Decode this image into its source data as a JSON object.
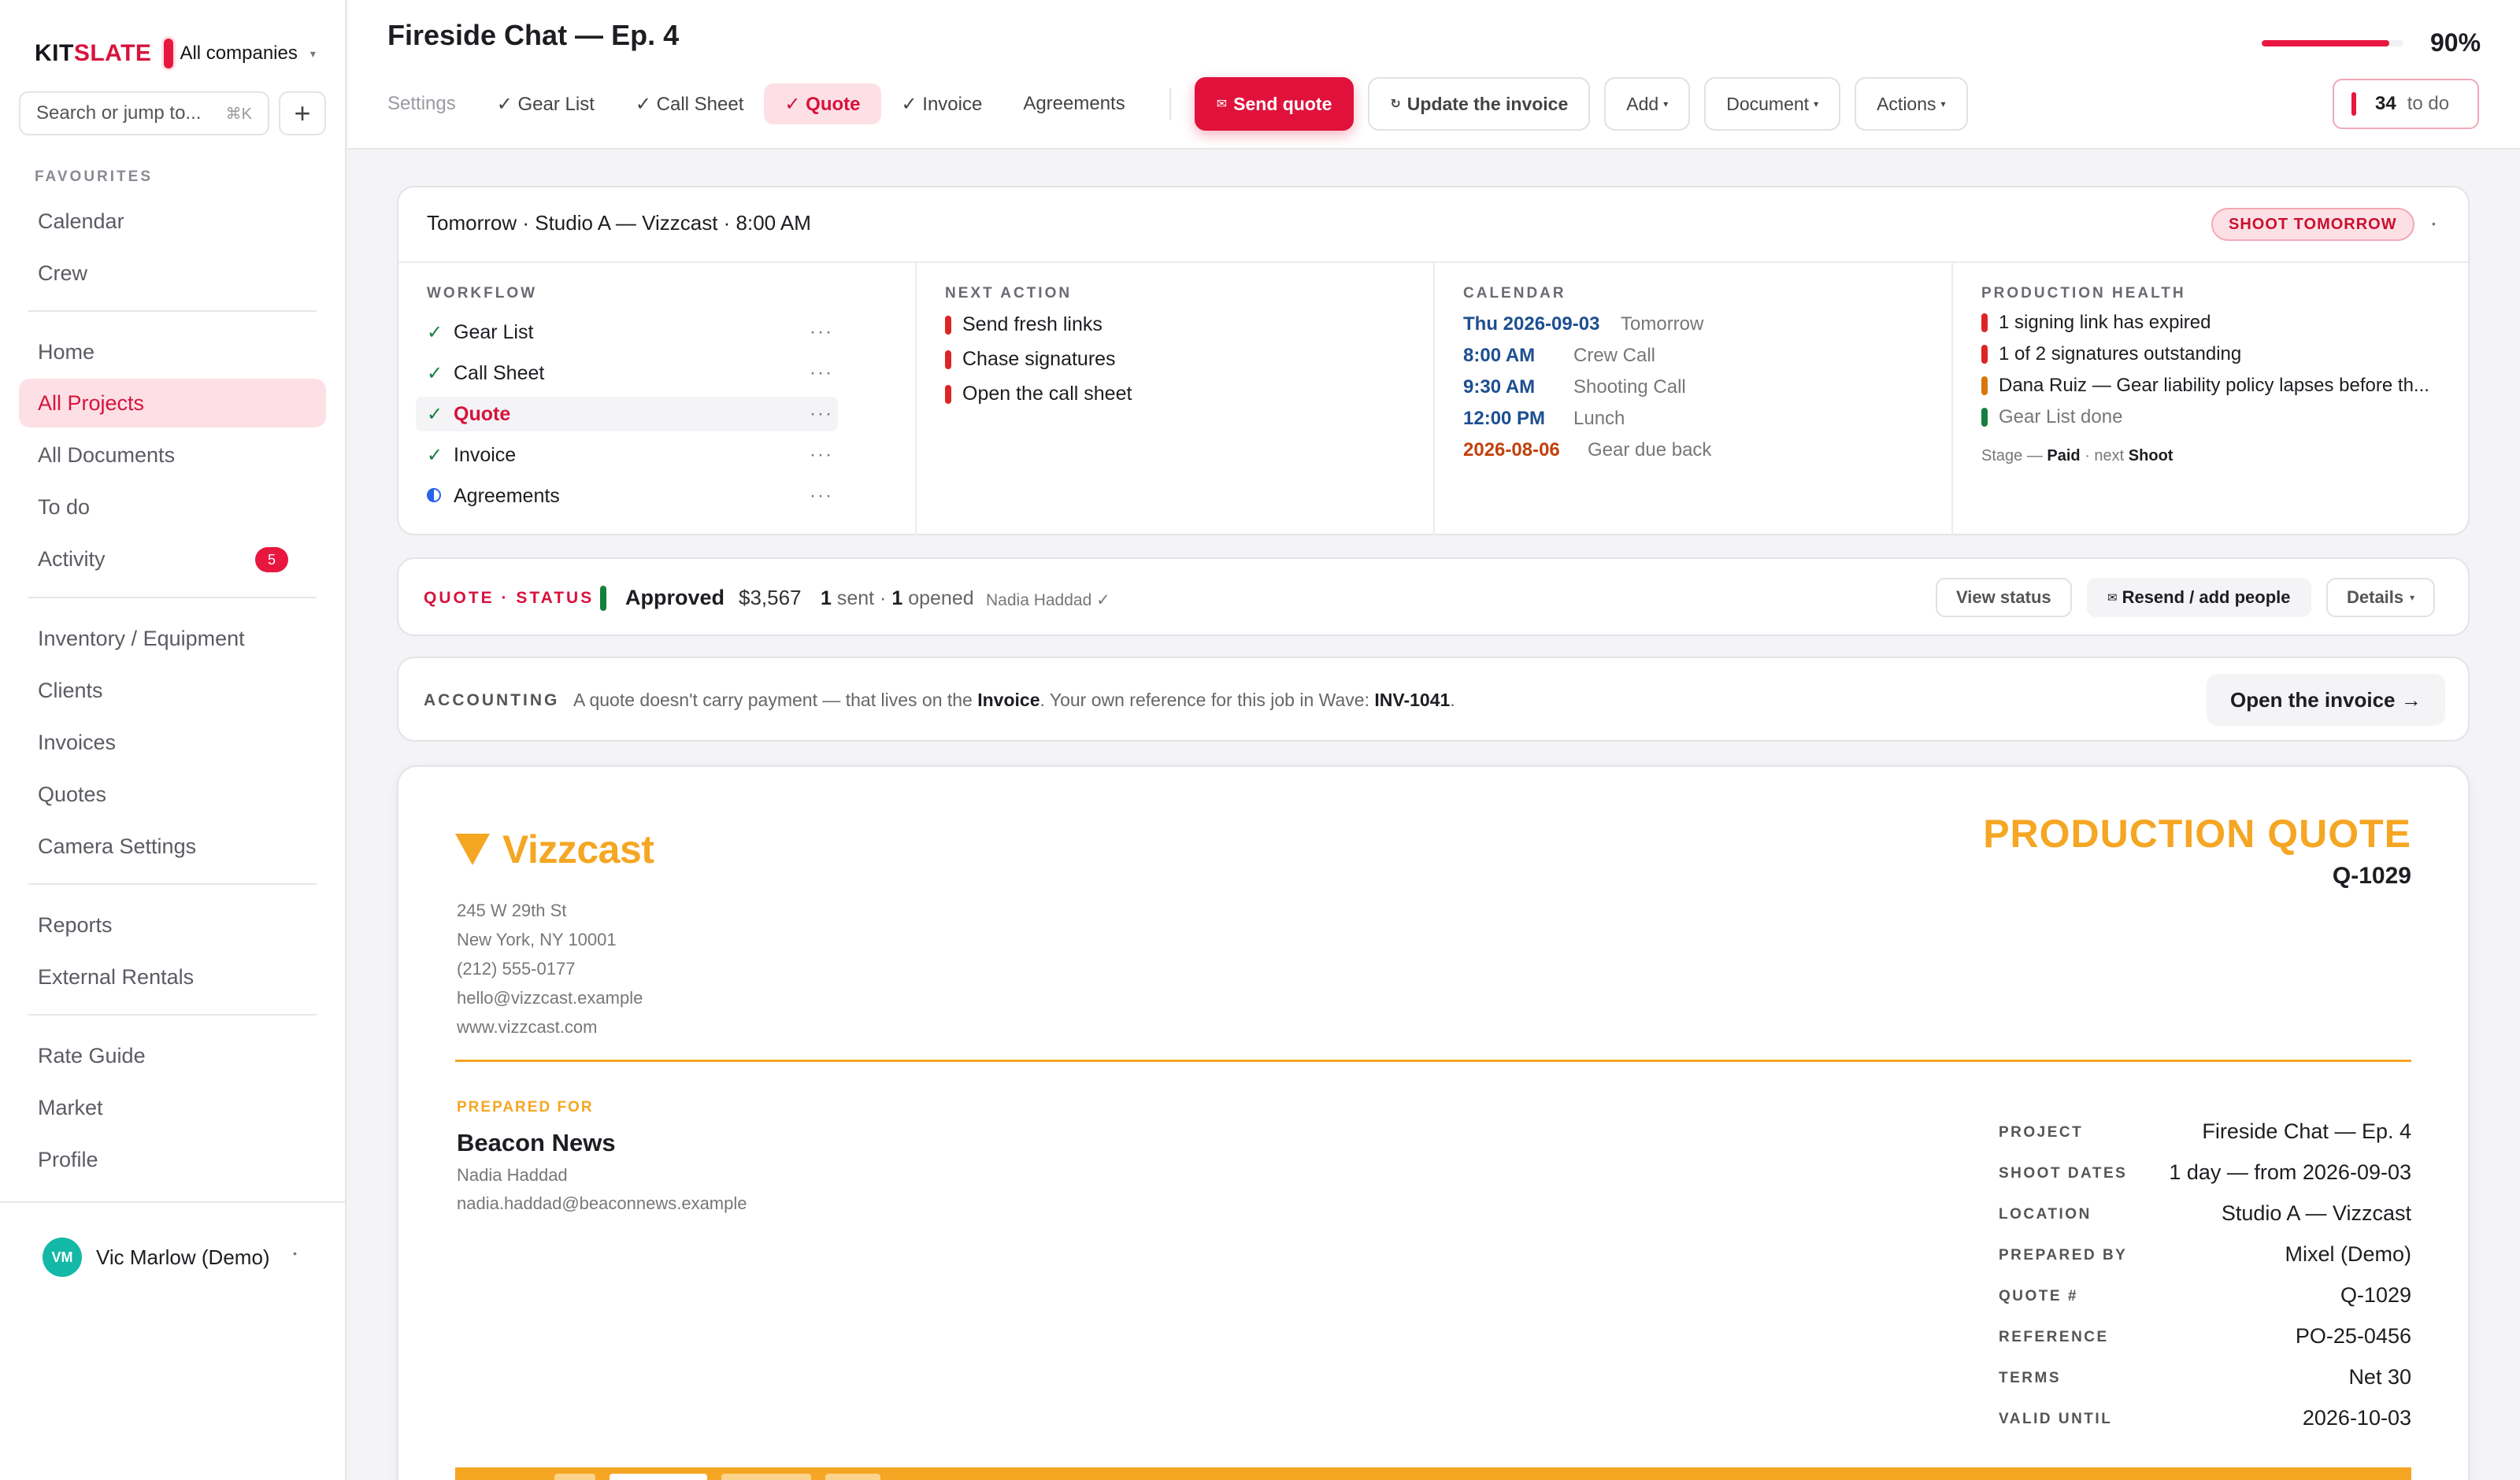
{
  "sidebar": {
    "brand": "KIT",
    "brand_accent": "SLATE",
    "company": "All companies",
    "search_placeholder": "Search or jump to...",
    "search_shortcut": "⌘K",
    "add_label": "+",
    "favourites_label": "FAVOURITES",
    "favourites": [
      "Calendar",
      "Crew"
    ],
    "group1": [
      "Home",
      "All Projects",
      "All Documents",
      "To do",
      "Activity"
    ],
    "activity_badge": "5",
    "group2": [
      "Inventory / Equipment",
      "Clients",
      "Invoices",
      "Quotes",
      "Camera Settings"
    ],
    "group3": [
      "Reports",
      "External Rentals"
    ],
    "group4": [
      "Rate Guide",
      "Market",
      "Profile"
    ],
    "user_initials": "VM",
    "user_name": "Vic Marlow (Demo)"
  },
  "header": {
    "title": "Fireside Chat — Ep. 4",
    "progress_percent": 90,
    "progress_label": "90%",
    "tabs": [
      "Settings",
      "✓ Gear List",
      "✓ Call Sheet",
      "✓ Quote",
      "✓ Invoice",
      "Agreements"
    ],
    "send_quote": "Send quote",
    "update_invoice": "Update the invoice",
    "add": "Add",
    "document": "Document",
    "actions": "Actions",
    "todo_count": "34",
    "todo_label": "to do"
  },
  "summary": {
    "headline": "Tomorrow · Studio A — Vizzcast · 8:00 AM",
    "badge": "SHOOT TOMORROW",
    "workflow_label": "WORKFLOW",
    "workflow": [
      "Gear List",
      "Call Sheet",
      "Quote",
      "Invoice",
      "Agreements"
    ],
    "next_action_label": "NEXT ACTION",
    "next_actions": [
      "Send fresh links",
      "Chase signatures",
      "Open the call sheet"
    ],
    "calendar_label": "CALENDAR",
    "calendar": [
      {
        "time": "Thu 2026-09-03",
        "desc": "Tomorrow"
      },
      {
        "time": "8:00 AM",
        "desc": "Crew Call"
      },
      {
        "time": "9:30 AM",
        "desc": "Shooting Call"
      },
      {
        "time": "12:00 PM",
        "desc": "Lunch"
      },
      {
        "time": "2026-08-06",
        "desc": "Gear due back"
      }
    ],
    "health_label": "PRODUCTION HEALTH",
    "health": [
      "1 signing link has expired",
      "1 of 2 signatures outstanding",
      "Dana Ruiz — Gear liability policy lapses before th...",
      "Gear List done"
    ],
    "stage_prefix": "Stage —",
    "stage_paid": "Paid",
    "stage_next": "· next",
    "stage_shoot": "Shoot"
  },
  "quote_status": {
    "label": "QUOTE · STATUS",
    "status": "Approved",
    "amount": "$3,567",
    "sent_count": "1",
    "sent_label": "sent ·",
    "opened_count": "1",
    "opened_label": "opened",
    "approved_by": "Nadia Haddad ✓",
    "view_status": "View status",
    "resend": "Resend / add people",
    "details": "Details"
  },
  "accounting": {
    "label": "ACCOUNTING",
    "text_pre": "A quote doesn't carry payment — that lives on the",
    "text_link": "Invoice",
    "text_mid": ". Your own reference for this job in Wave:",
    "ref": "INV-1041",
    "text_end": ".",
    "open_invoice": "Open the invoice →"
  },
  "document": {
    "company": "Vizzcast",
    "address": [
      "245 W 29th St",
      "New York, NY 10001",
      "(212) 555-0177",
      "hello@vizzcast.example",
      "www.vizzcast.com"
    ],
    "title": "PRODUCTION QUOTE",
    "quote_number": "Q-1029",
    "prepared_for_label": "PREPARED FOR",
    "client_company": "Beacon News",
    "client_person": "Nadia Haddad",
    "client_email": "nadia.haddad@beaconnews.example",
    "meta": [
      {
        "label": "PROJECT",
        "value": "Fireside Chat — Ep. 4"
      },
      {
        "label": "SHOOT DATES",
        "value": "1 day — from 2026-09-03"
      },
      {
        "label": "LOCATION",
        "value": "Studio A — Vizzcast"
      },
      {
        "label": "PREPARED BY",
        "value": "Mixel (Demo)"
      },
      {
        "label": "QUOTE #",
        "value": "Q-1029"
      },
      {
        "label": "REFERENCE",
        "value": "PO-25-0456"
      },
      {
        "label": "TERMS",
        "value": "Net 30"
      },
      {
        "label": "VALID UNTIL",
        "value": "2026-10-03"
      }
    ]
  },
  "colors": {
    "accent": "#e0123c",
    "brand_orange": "#f5a623",
    "success": "#15803d"
  }
}
